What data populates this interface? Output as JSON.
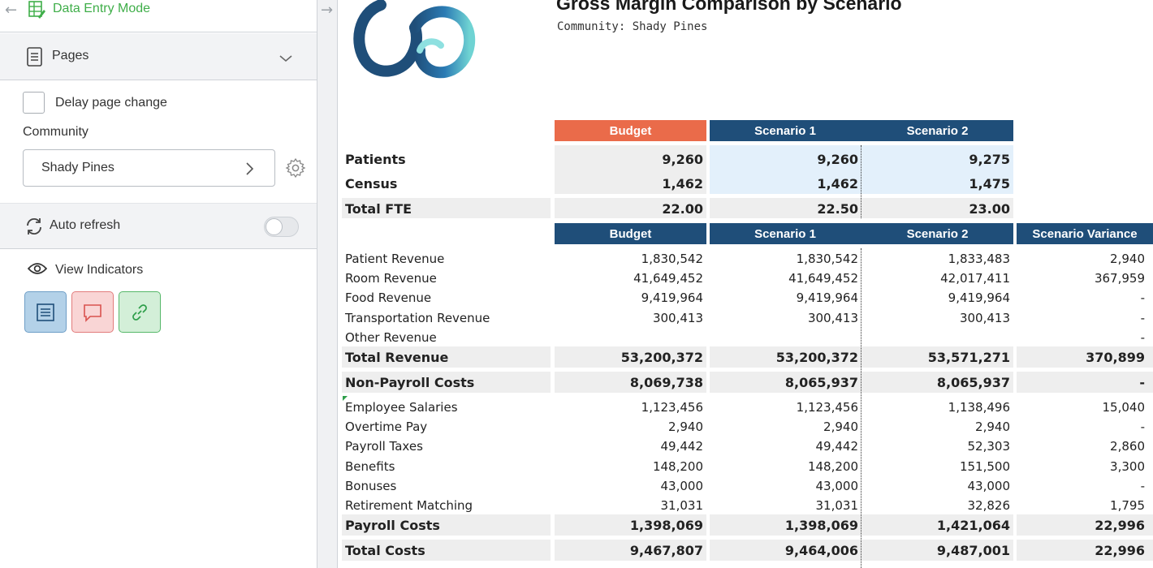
{
  "sidebar": {
    "mode_label": "Data Entry Mode",
    "pages_label": "Pages",
    "delay_label": "Delay page change",
    "community_label": "Community",
    "community_value": "Shady Pines",
    "auto_refresh_label": "Auto refresh",
    "view_indicators_label": "View Indicators"
  },
  "report": {
    "title": "Gross Margin Comparison by Scenario",
    "subtitle": "Community: Shady Pines",
    "top_headers": [
      "Budget",
      "Scenario 1",
      "Scenario 2"
    ],
    "top_rows": [
      {
        "label": "Patients",
        "values": [
          "9,260",
          "9,260",
          "9,275"
        ]
      },
      {
        "label": "Census",
        "values": [
          "1,462",
          "1,462",
          "1,475"
        ]
      },
      {
        "label": "Total FTE",
        "values": [
          "22.00",
          "22.50",
          "23.00"
        ]
      }
    ],
    "headers": [
      "Budget",
      "Scenario 1",
      "Scenario 2",
      "Scenario Variance"
    ],
    "rows": [
      {
        "label": "Patient Revenue",
        "values": [
          "1,830,542",
          "1,830,542",
          "1,833,483",
          "2,940"
        ]
      },
      {
        "label": "Room Revenue",
        "values": [
          "41,649,452",
          "41,649,452",
          "42,017,411",
          "367,959"
        ]
      },
      {
        "label": "Food Revenue",
        "values": [
          "9,419,964",
          "9,419,964",
          "9,419,964",
          "-"
        ]
      },
      {
        "label": "Transportation Revenue",
        "values": [
          "300,413",
          "300,413",
          "300,413",
          "-"
        ]
      },
      {
        "label": "Other Revenue",
        "values": [
          "",
          "",
          "",
          "-"
        ]
      },
      {
        "label": "Total Revenue",
        "values": [
          "53,200,372",
          "53,200,372",
          "53,571,271",
          "370,899"
        ]
      },
      {
        "label": "Non-Payroll Costs",
        "values": [
          "8,069,738",
          "8,065,937",
          "8,065,937",
          "-"
        ]
      },
      {
        "label": "Employee Salaries",
        "values": [
          "1,123,456",
          "1,123,456",
          "1,138,496",
          "15,040"
        ]
      },
      {
        "label": "Overtime Pay",
        "values": [
          "2,940",
          "2,940",
          "2,940",
          "-"
        ]
      },
      {
        "label": "Payroll Taxes",
        "values": [
          "49,442",
          "49,442",
          "52,303",
          "2,860"
        ]
      },
      {
        "label": "Benefits",
        "values": [
          "148,200",
          "148,200",
          "151,500",
          "3,300"
        ]
      },
      {
        "label": "Bonuses",
        "values": [
          "43,000",
          "43,000",
          "43,000",
          "-"
        ]
      },
      {
        "label": "Retirement Matching",
        "values": [
          "31,031",
          "31,031",
          "32,826",
          "1,795"
        ]
      },
      {
        "label": "Payroll Costs",
        "values": [
          "1,398,069",
          "1,398,069",
          "1,421,064",
          "22,996"
        ]
      },
      {
        "label": "Total Costs",
        "values": [
          "9,467,807",
          "9,464,006",
          "9,487,001",
          "22,996"
        ]
      }
    ]
  }
}
